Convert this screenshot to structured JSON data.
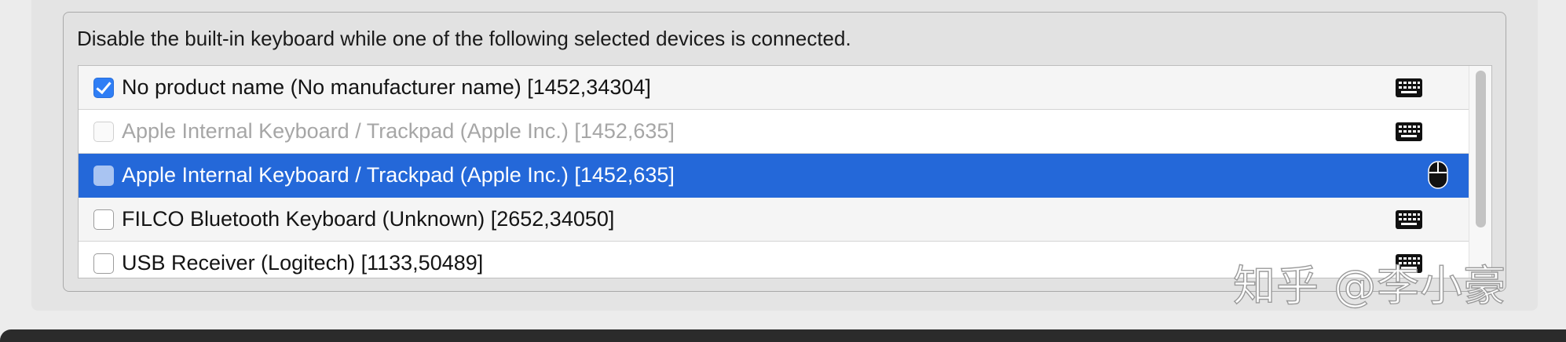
{
  "description": "Disable the built-in keyboard while one of the following selected devices is connected.",
  "devices": [
    {
      "label": "No product name (No manufacturer name) [1452,34304]",
      "checked": true,
      "enabled": true,
      "selected": false,
      "icon": "keyboard-icon"
    },
    {
      "label": "Apple Internal Keyboard / Trackpad (Apple Inc.) [1452,635]",
      "checked": false,
      "enabled": false,
      "selected": false,
      "icon": "keyboard-icon"
    },
    {
      "label": "Apple Internal Keyboard / Trackpad (Apple Inc.) [1452,635]",
      "checked": false,
      "enabled": true,
      "selected": true,
      "icon": "mouse-icon"
    },
    {
      "label": "FILCO Bluetooth Keyboard (Unknown) [2652,34050]",
      "checked": false,
      "enabled": true,
      "selected": false,
      "icon": "keyboard-icon"
    },
    {
      "label": "USB Receiver (Logitech) [1133,50489]",
      "checked": false,
      "enabled": true,
      "selected": false,
      "icon": "keyboard-icon"
    }
  ],
  "watermark": "知乎 @李小豪",
  "colors": {
    "selection": "#2468d9",
    "checkbox_checked": "#2f7ef5"
  }
}
